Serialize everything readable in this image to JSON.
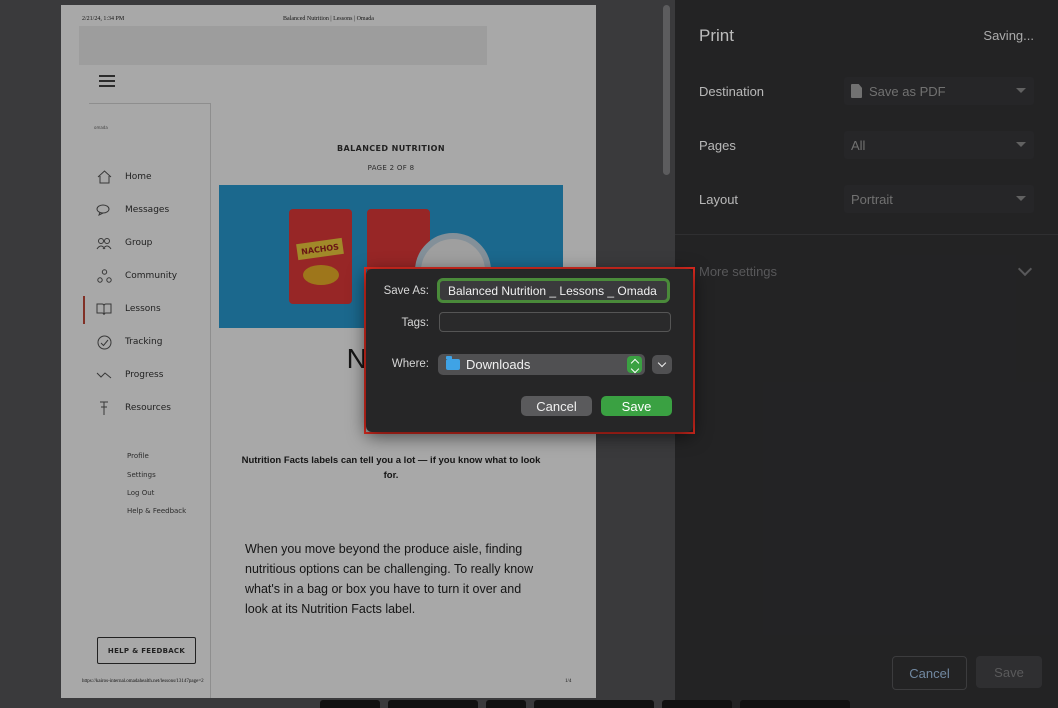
{
  "print_preview": {
    "header_date": "2/21/24, 1:34 PM",
    "header_title": "Balanced Nutrition | Lessons | Omada",
    "logo_text": "omada",
    "nav": [
      {
        "label": "Home",
        "icon": "home-icon"
      },
      {
        "label": "Messages",
        "icon": "messages-icon"
      },
      {
        "label": "Group",
        "icon": "group-icon"
      },
      {
        "label": "Community",
        "icon": "community-icon"
      },
      {
        "label": "Lessons",
        "icon": "lessons-icon"
      },
      {
        "label": "Tracking",
        "icon": "tracking-icon"
      },
      {
        "label": "Progress",
        "icon": "progress-icon"
      },
      {
        "label": "Resources",
        "icon": "resources-icon"
      }
    ],
    "active_nav": "Lessons",
    "sub_links": [
      "Profile",
      "Settings",
      "Log Out",
      "Help & Feedback"
    ],
    "help_button": "HELP & FEEDBACK",
    "lesson_title": "BALANCED NUTRITION",
    "lesson_page": "PAGE 2 OF 8",
    "bag_label": "NACHOS",
    "big_title_line1": "Nutritio",
    "big_title_line2": "N",
    "intro": "Nutrition Facts labels can tell you a lot — if you know what to look for.",
    "body": "When you move beyond the produce aisle, finding nutritious options can be challenging. To really know what's in a bag or box you have to turn it over and look at its Nutrition Facts label.",
    "footer_url": "https://kairos-internal.omadahealth.net/lessons/13147page=2",
    "footer_page": "1/4"
  },
  "print_panel": {
    "title": "Print",
    "status": "Saving...",
    "destination_label": "Destination",
    "destination_value": "Save as PDF",
    "pages_label": "Pages",
    "pages_value": "All",
    "layout_label": "Layout",
    "layout_value": "Portrait",
    "more_settings": "More settings",
    "cancel": "Cancel",
    "save": "Save"
  },
  "save_dialog": {
    "save_as_label": "Save As:",
    "save_as_value": "Balanced Nutrition _ Lessons _ Omada",
    "tags_label": "Tags:",
    "tags_value": "",
    "where_label": "Where:",
    "where_value": "Downloads",
    "cancel": "Cancel",
    "save": "Save",
    "accent_color": "#3aa142",
    "highlight_color": "#e02b20"
  }
}
